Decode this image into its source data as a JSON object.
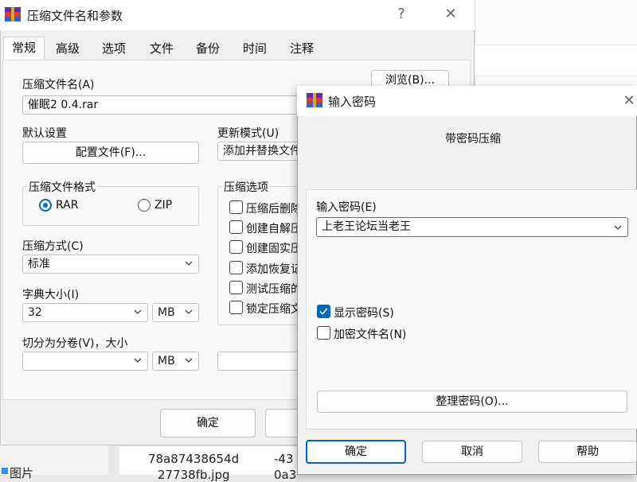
{
  "background": {
    "file_name_1": "78a87438654d",
    "file_name_2": "-43",
    "file_name_3": "27738fb.jpg",
    "file_name_4": "0a3",
    "sidebar_item": "图片"
  },
  "main_dialog": {
    "title": "压缩文件名和参数",
    "help_glyph": "?",
    "close_glyph": "✕",
    "tabs": [
      "常规",
      "高级",
      "选项",
      "文件",
      "备份",
      "时间",
      "注释"
    ],
    "archive_name_label": "压缩文件名(A)",
    "archive_name_value": "催眠2     0.4.rar",
    "browse_button": "浏览(B)...",
    "default_settings_label": "默认设置",
    "profiles_button": "配置文件(F)...",
    "update_mode_label": "更新模式(U)",
    "update_mode_value": "添加并替换文件",
    "format_group_label": "压缩文件格式",
    "format_rar": "RAR",
    "format_zip": "ZIP",
    "method_label": "压缩方式(C)",
    "method_value": "标准",
    "dict_label": "字典大小(I)",
    "dict_value": "32",
    "dict_unit": "MB",
    "split_label": "切分为分卷(V)，大小",
    "split_value": "",
    "split_unit": "MB",
    "options_group_label": "压缩选项",
    "options": [
      "压缩后删除",
      "创建自解压",
      "创建固实压",
      "添加恢复记",
      "测试压缩的",
      "锁定压缩文"
    ],
    "ok_button": "确定"
  },
  "password_dialog": {
    "title": "输入密码",
    "close_glyph": "✕",
    "subtitle": "带密码压缩",
    "password_label": "输入密码(E)",
    "password_value": "上老王论坛当老王",
    "show_password_label": "显示密码(S)",
    "show_password_checked": true,
    "encrypt_names_label": "加密文件名(N)",
    "encrypt_names_checked": false,
    "organize_button": "整理密码(O)...",
    "ok_button": "确定",
    "cancel_button": "取消",
    "help_button": "帮助"
  },
  "colors": {
    "accent": "#0067c0"
  }
}
